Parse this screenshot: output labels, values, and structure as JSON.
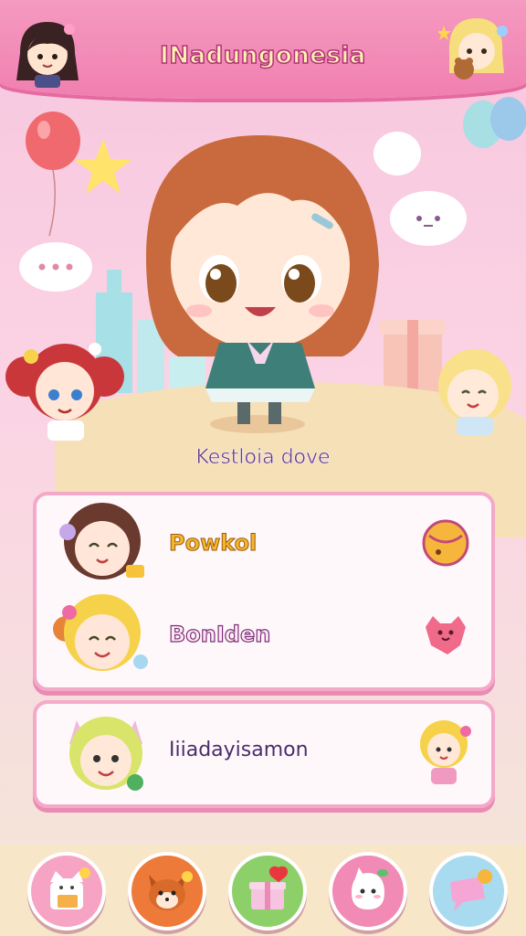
{
  "header": {
    "title": "INadungonesia"
  },
  "main": {
    "player_name": "Kestloia dove"
  },
  "list": {
    "rows": [
      {
        "label": "Powkol"
      },
      {
        "label": "BonIden"
      },
      {
        "label": "Iiiadayisamon"
      }
    ]
  },
  "colors": {
    "header": "#f07fb0",
    "card_border": "#f4a9c8",
    "nav_bg": "#f8e6c8",
    "gold_text": "#f4b62a",
    "purple_text": "#7b2f7a"
  },
  "nav": {
    "items": [
      {
        "icon": "cat-box-icon"
      },
      {
        "icon": "fox-face-icon"
      },
      {
        "icon": "gift-heart-icon"
      },
      {
        "icon": "ghost-pet-icon"
      },
      {
        "icon": "chat-bubble-icon"
      }
    ]
  }
}
